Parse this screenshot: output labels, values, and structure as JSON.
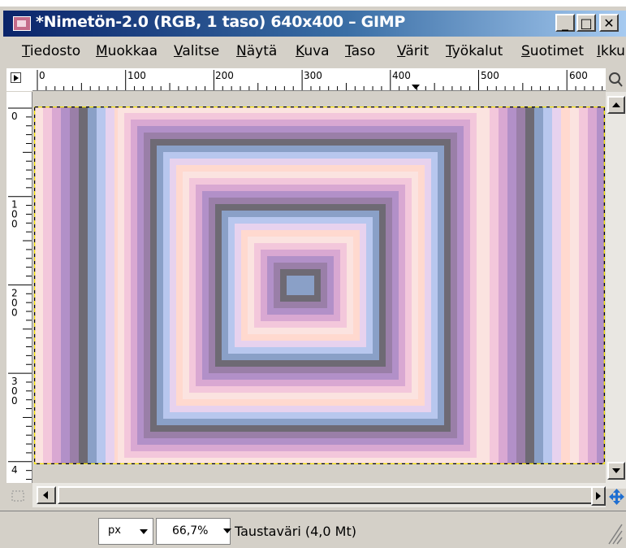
{
  "window": {
    "title": "*Nimetön-2.0 (RGB, 1 taso) 640x400 – GIMP",
    "minimize_glyph": "_",
    "maximize_glyph": "□",
    "close_glyph": "✕"
  },
  "menu": {
    "items": [
      {
        "mnemonic": "T",
        "rest": "iedosto"
      },
      {
        "mnemonic": "M",
        "rest": "uokkaa"
      },
      {
        "mnemonic": "V",
        "rest": "alitse"
      },
      {
        "mnemonic": "N",
        "rest": "äytä"
      },
      {
        "mnemonic": "K",
        "rest": "uva"
      },
      {
        "mnemonic": "T",
        "rest": "aso",
        "prefix": ""
      },
      {
        "mnemonic": "V",
        "rest": "ärit"
      },
      {
        "mnemonic": "T",
        "rest": "yökalut"
      },
      {
        "mnemonic": "S",
        "rest": "uotimet"
      },
      {
        "mnemonic": "I",
        "rest": "kku"
      }
    ]
  },
  "rulers": {
    "horizontal_labels": [
      "0",
      "100",
      "200",
      "300",
      "400",
      "500",
      "600"
    ],
    "vertical_labels": [
      "0",
      "100",
      "200",
      "300",
      "4"
    ]
  },
  "statusbar": {
    "unit": "px",
    "zoom": "66,7%",
    "info": "Taustaväri (4,0 Mt)"
  },
  "icons": {
    "menu_toggle": "triangle-right-icon",
    "zoom_fit": "zoom-icon",
    "navigate": "four-way-arrow-icon",
    "quick_mask": "quick-mask-icon",
    "resize_grip": "resize-grip-icon"
  },
  "colors": {
    "title_start": "#0a246a",
    "title_end": "#a6caf0",
    "palette": [
      "#fbe3e0",
      "#f3c7db",
      "#d9a8d2",
      "#b290c8",
      "#9a7fa8",
      "#6e6a74",
      "#8aa0c7",
      "#b8c7ee",
      "#e7d2ee",
      "#ffd9cf"
    ]
  }
}
